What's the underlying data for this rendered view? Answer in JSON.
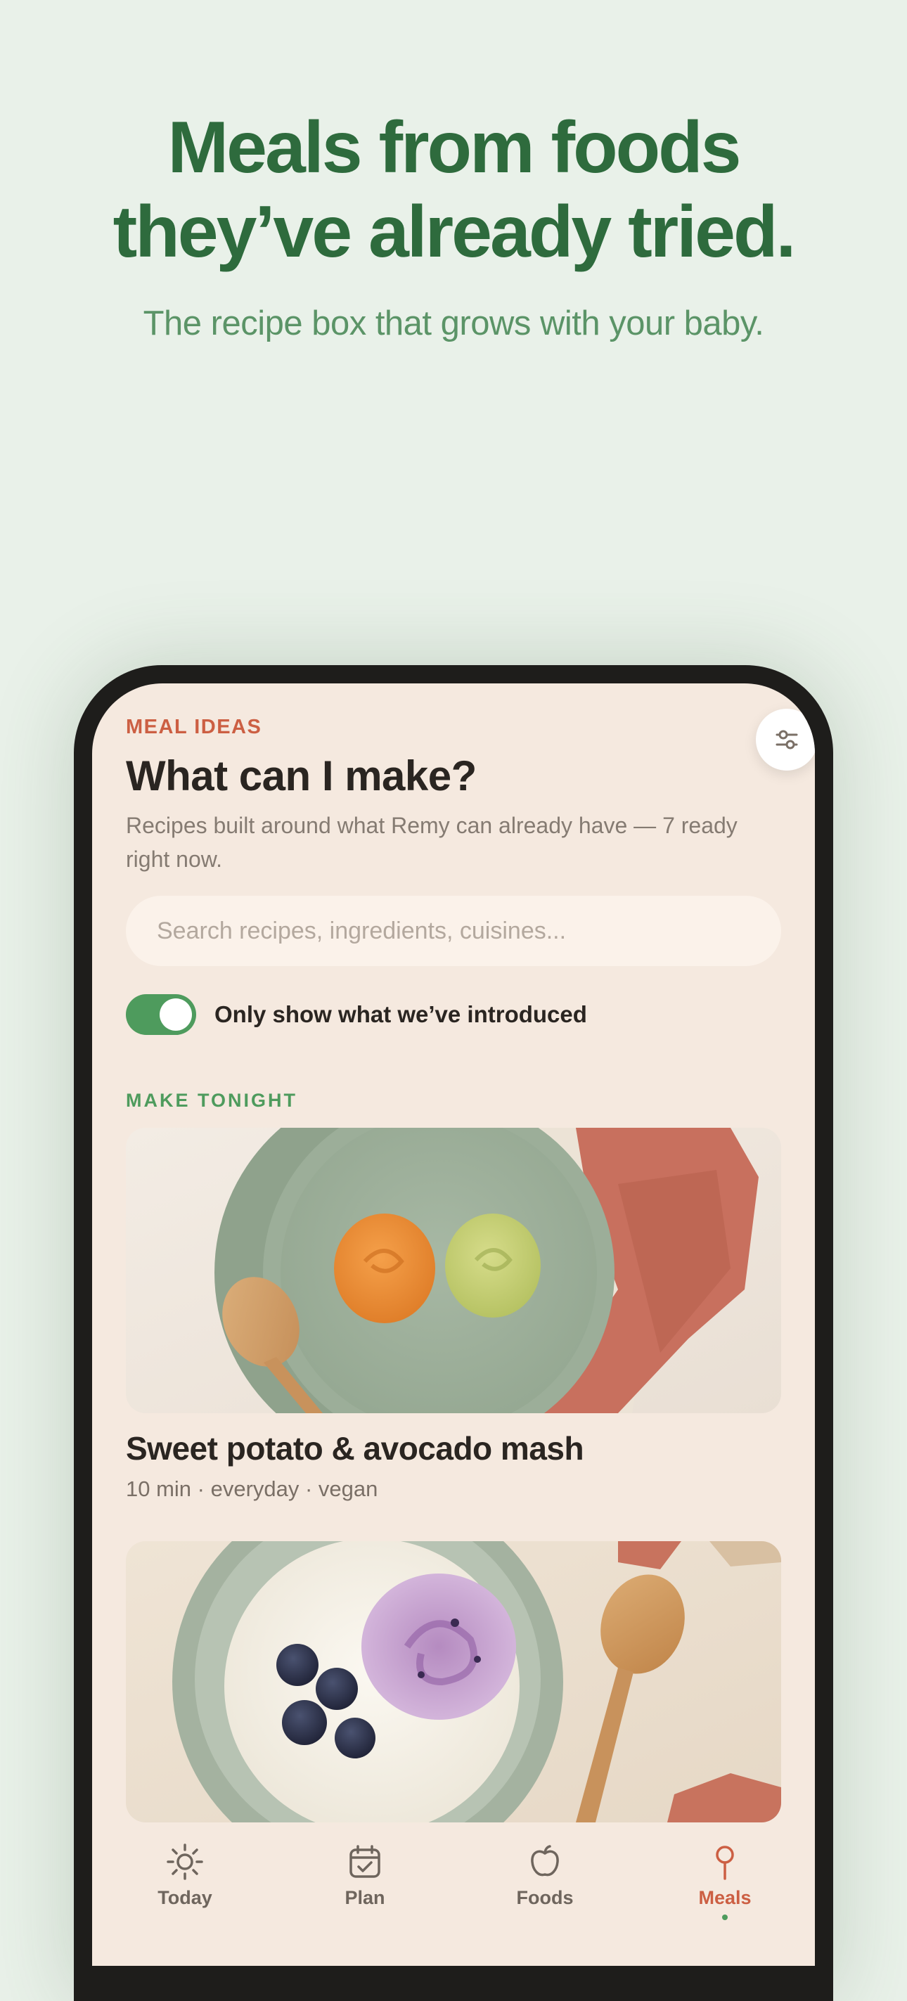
{
  "hero": {
    "title_line1": "Meals from foods",
    "title_line2": "they’ve already tried.",
    "subtitle": "The recipe box that grows with your baby."
  },
  "app": {
    "eyebrow": "MEAL IDEAS",
    "title": "What can I make?",
    "description": "Recipes built around what Remy can already have — 7 ready right now.",
    "search_placeholder": "Search recipes, ingredients, cuisines...",
    "filter_icon": "sliders-icon",
    "toggle": {
      "label": "Only show what we’ve introduced",
      "on": true
    },
    "section_label": "MAKE TONIGHT",
    "recipes": [
      {
        "title": "Sweet potato & avocado mash",
        "meta": "10 min · everyday · vegan",
        "image": "plate-with-purees-photo"
      },
      {
        "title": "",
        "meta": "",
        "image": "yogurt-with-blueberries-photo"
      }
    ]
  },
  "tabbar": {
    "tabs": [
      {
        "label": "Today",
        "icon": "sun-icon",
        "active": false
      },
      {
        "label": "Plan",
        "icon": "calendar-check-icon",
        "active": false
      },
      {
        "label": "Foods",
        "icon": "apple-icon",
        "active": false
      },
      {
        "label": "Meals",
        "icon": "pin-icon",
        "active": true
      }
    ]
  },
  "colors": {
    "background": "#e9f1e9",
    "hero_title": "#2e6b3d",
    "hero_subtitle": "#5b9467",
    "screen": "#f5e9df",
    "accent_terracotta": "#cc5f43",
    "accent_green": "#4e9b5d"
  }
}
